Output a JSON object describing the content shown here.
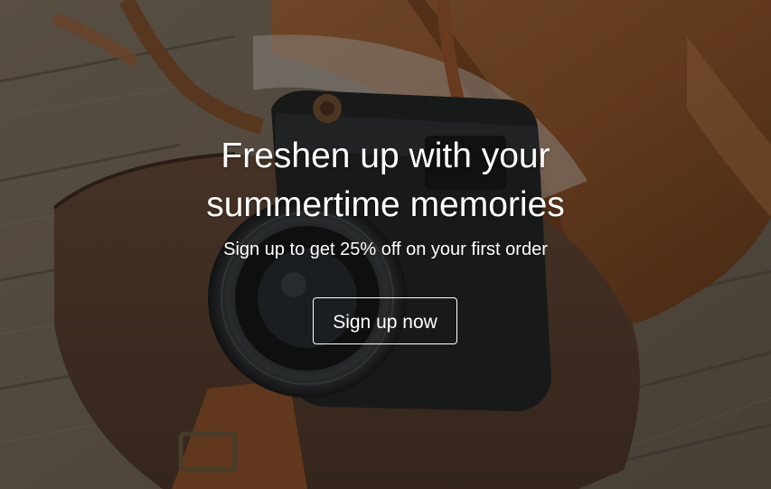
{
  "hero": {
    "headline_line1": "Freshen up with your",
    "headline_line2": "summertime memories",
    "subheadline": "Sign up to get 25% off on your first order",
    "cta_label": "Sign up now"
  },
  "colors": {
    "text": "#ffffff",
    "cta_border": "#ffffff",
    "overlay": "rgba(20,18,16,0.42)"
  },
  "background": {
    "subject": "camera-on-leather-bag-photo"
  }
}
